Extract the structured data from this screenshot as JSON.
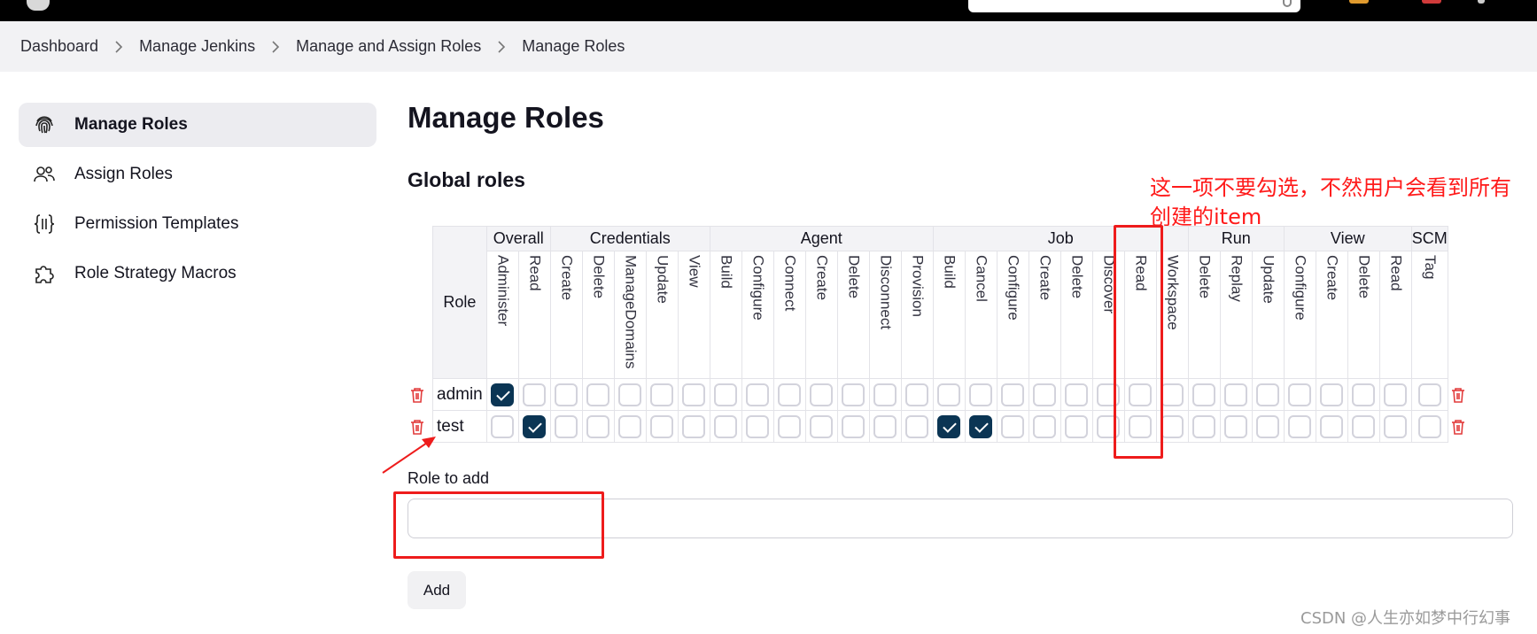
{
  "breadcrumb": [
    "Dashboard",
    "Manage Jenkins",
    "Manage and Assign Roles",
    "Manage Roles"
  ],
  "sidebar": {
    "items": [
      {
        "label": "Manage Roles",
        "icon": "fingerprint-icon",
        "active": true
      },
      {
        "label": "Assign Roles",
        "icon": "users-icon",
        "active": false
      },
      {
        "label": "Permission Templates",
        "icon": "braces-icon",
        "active": false
      },
      {
        "label": "Role Strategy Macros",
        "icon": "puzzle-icon",
        "active": false
      }
    ]
  },
  "main": {
    "title": "Manage Roles",
    "section_title": "Global roles",
    "role_header": "Role",
    "groups": [
      {
        "name": "Overall",
        "permissions": [
          "Administer",
          "Read"
        ]
      },
      {
        "name": "Credentials",
        "permissions": [
          "Create",
          "Delete",
          "ManageDomains",
          "Update",
          "View"
        ]
      },
      {
        "name": "Agent",
        "permissions": [
          "Build",
          "Configure",
          "Connect",
          "Create",
          "Delete",
          "Disconnect",
          "Provision"
        ]
      },
      {
        "name": "Job",
        "permissions": [
          "Build",
          "Cancel",
          "Configure",
          "Create",
          "Delete",
          "Discover",
          "Read",
          "Workspace"
        ]
      },
      {
        "name": "Run",
        "permissions": [
          "Delete",
          "Replay",
          "Update"
        ]
      },
      {
        "name": "View",
        "permissions": [
          "Configure",
          "Create",
          "Delete",
          "Read"
        ]
      },
      {
        "name": "SCM",
        "permissions": [
          "Tag"
        ]
      }
    ],
    "roles": [
      {
        "name": "admin",
        "checked": [
          0
        ]
      },
      {
        "name": "test",
        "checked": [
          1,
          14,
          15
        ]
      }
    ],
    "role_to_add_label": "Role to add",
    "role_input_value": "",
    "add_button_label": "Add"
  },
  "annotation": {
    "text": "这一项不要勾选，不然用户会看到所有创建的item"
  },
  "watermark": "CSDN @人生亦如梦中行幻事",
  "colors": {
    "accent": "#0b3554",
    "danger": "#e23c3c",
    "annotation_red": "#ee1c1c"
  }
}
